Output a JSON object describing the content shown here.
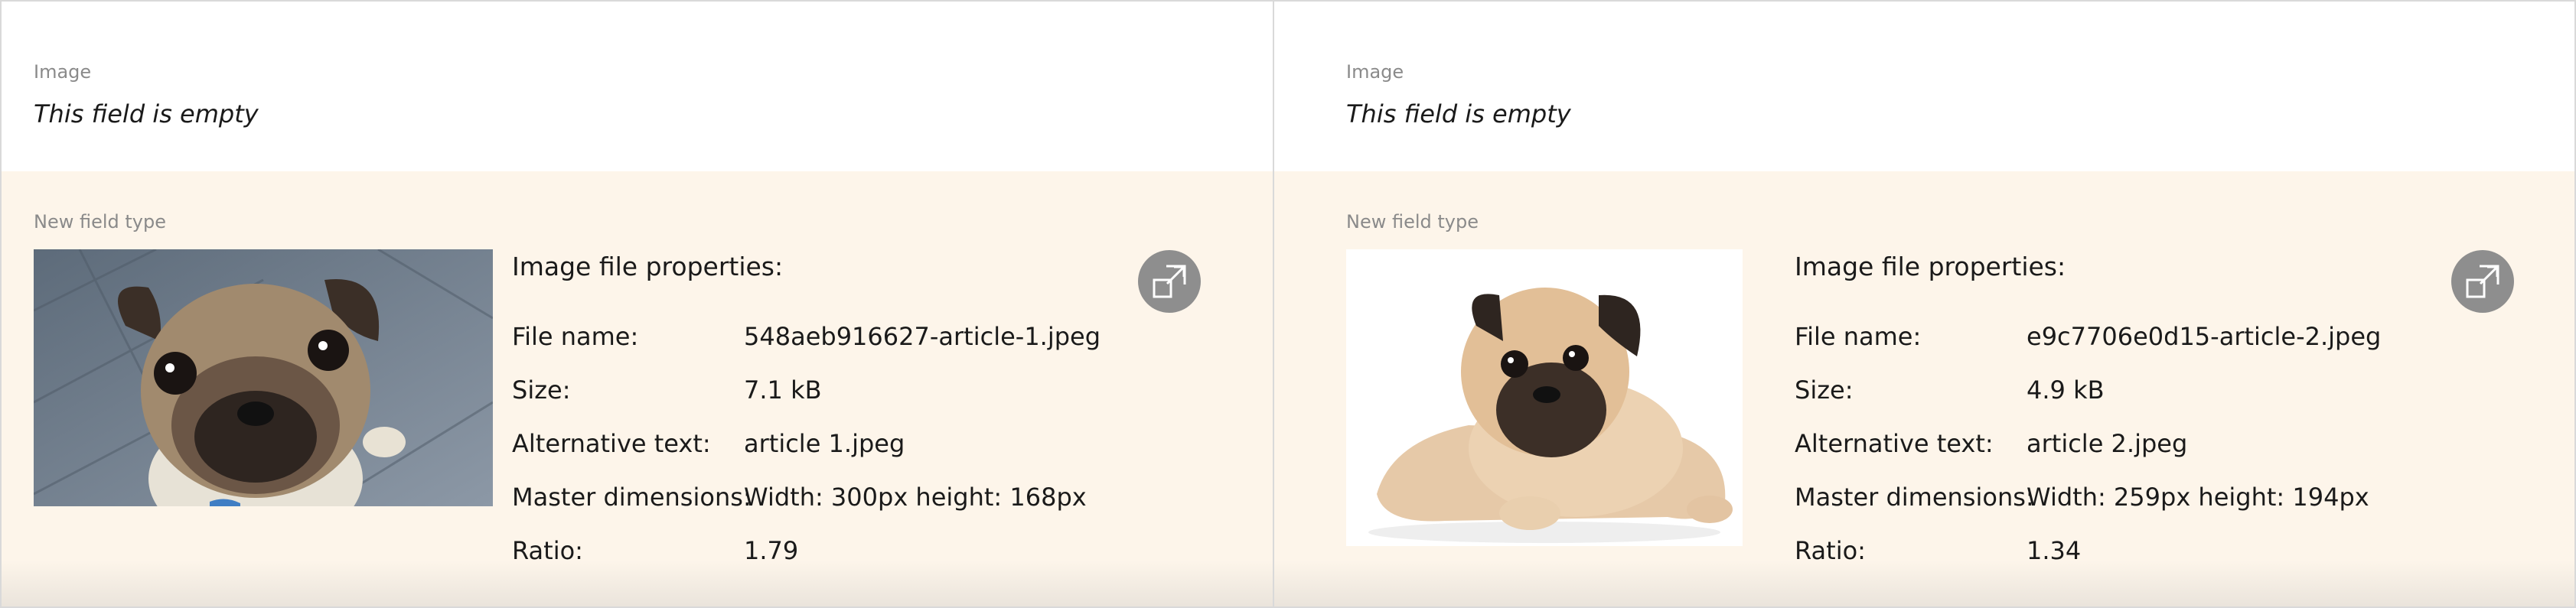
{
  "panels": [
    {
      "image_field": {
        "label": "Image",
        "value": "This field is empty"
      },
      "new_field": {
        "label": "New field type",
        "props_title": "Image file properties:",
        "properties": [
          {
            "key": "File name:",
            "value": "548aeb916627-article-1.jpeg"
          },
          {
            "key": "Size:",
            "value": "7.1 kB"
          },
          {
            "key": "Alternative text:",
            "value": "article 1.jpeg"
          },
          {
            "key": "Master dimensions:",
            "value": "Width: 300px height: 168px"
          },
          {
            "key": "Ratio:",
            "value": "1.79"
          }
        ],
        "open_icon": "open-external-icon"
      }
    },
    {
      "image_field": {
        "label": "Image",
        "value": "This field is empty"
      },
      "new_field": {
        "label": "New field type",
        "props_title": "Image file properties:",
        "properties": [
          {
            "key": "File name:",
            "value": "e9c7706e0d15-article-2.jpeg"
          },
          {
            "key": "Size:",
            "value": "4.9 kB"
          },
          {
            "key": "Alternative text:",
            "value": "article 2.jpeg"
          },
          {
            "key": "Master dimensions:",
            "value": "Width: 259px height: 194px"
          },
          {
            "key": "Ratio:",
            "value": "1.34"
          }
        ],
        "open_icon": "open-external-icon"
      }
    }
  ]
}
